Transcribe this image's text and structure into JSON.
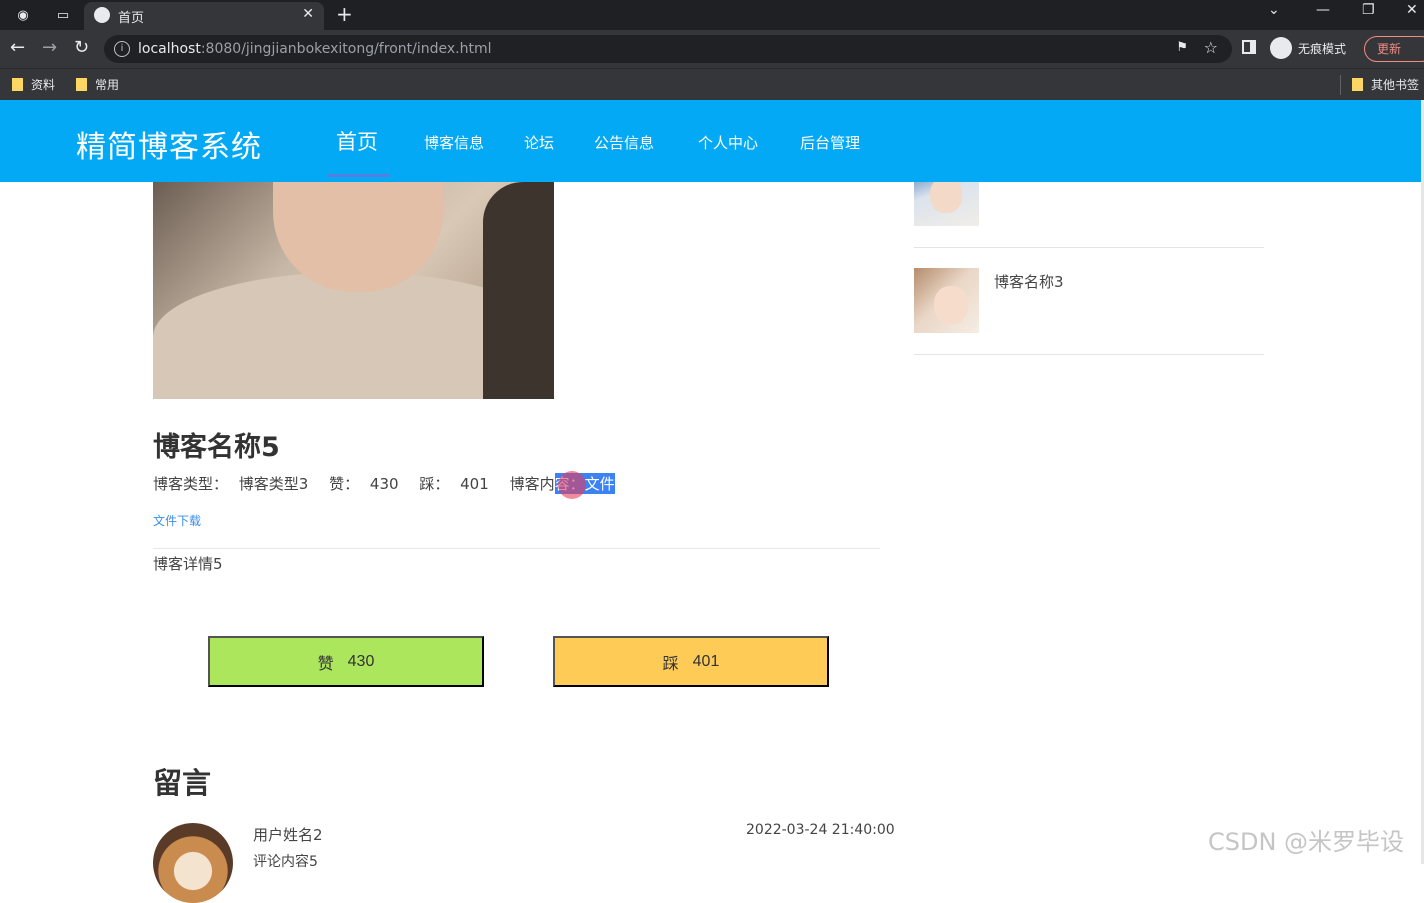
{
  "browser": {
    "tab_title": "首页",
    "url_host": "localhost",
    "url_path": ":8080/jingjianbokexitong/front/index.html",
    "incognito_label": "无痕模式",
    "update_label": "更新",
    "bookmarks": [
      "资料",
      "常用"
    ],
    "other_bookmarks": "其他书签"
  },
  "site": {
    "logo": "精简博客系统",
    "nav": [
      "首页",
      "博客信息",
      "论坛",
      "公告信息",
      "个人中心",
      "后台管理"
    ],
    "active_nav": "首页",
    "accent_color": "#03a9f4"
  },
  "blog": {
    "title": "博客名称5",
    "type_label": "博客类型：",
    "type_value": "博客类型3",
    "like_label": "赞：",
    "like_value": "430",
    "dislike_label": "踩：",
    "dislike_value": "401",
    "content_label_plain": "博客内",
    "content_label_selected": "容：",
    "content_value": "文件",
    "download_link": "文件下载",
    "detail": "博客详情5"
  },
  "votes": {
    "like_label": "赞",
    "like_count": "430",
    "like_color": "#abe65c",
    "dislike_label": "踩",
    "dislike_count": "401",
    "dislike_color": "#ffcb57"
  },
  "messages": {
    "title": "留言",
    "items": [
      {
        "user": "用户姓名2",
        "content": "评论内容5",
        "time": "2022-03-24 21:40:00"
      }
    ]
  },
  "sidebar": {
    "items": [
      {
        "name": ""
      },
      {
        "name": "博客名称3"
      }
    ]
  },
  "watermark": "CSDN @米罗毕设"
}
